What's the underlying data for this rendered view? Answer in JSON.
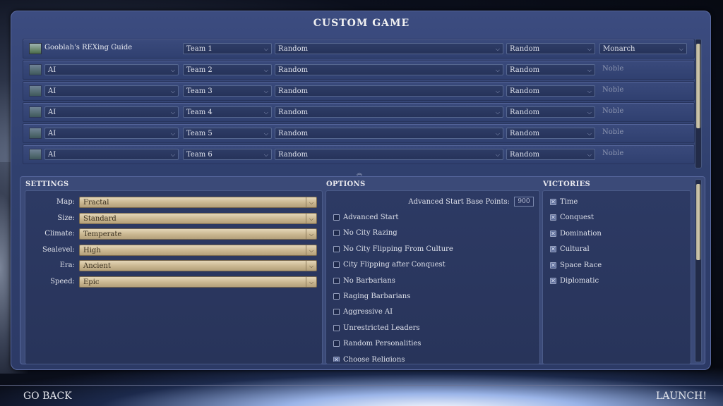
{
  "title": "CUSTOM GAME",
  "players": [
    {
      "leader": "Gooblah's REXing Guide",
      "team": "Team 1",
      "civ": "Random",
      "leader_choice": "Random",
      "difficulty": "Monarch",
      "difficulty_is_dropdown": true,
      "human": true
    },
    {
      "leader": "AI",
      "team": "Team 2",
      "civ": "Random",
      "leader_choice": "Random",
      "difficulty": "Noble",
      "difficulty_is_dropdown": false,
      "human": false
    },
    {
      "leader": "AI",
      "team": "Team 3",
      "civ": "Random",
      "leader_choice": "Random",
      "difficulty": "Noble",
      "difficulty_is_dropdown": false,
      "human": false
    },
    {
      "leader": "AI",
      "team": "Team 4",
      "civ": "Random",
      "leader_choice": "Random",
      "difficulty": "Noble",
      "difficulty_is_dropdown": false,
      "human": false
    },
    {
      "leader": "AI",
      "team": "Team 5",
      "civ": "Random",
      "leader_choice": "Random",
      "difficulty": "Noble",
      "difficulty_is_dropdown": false,
      "human": false
    },
    {
      "leader": "AI",
      "team": "Team 6",
      "civ": "Random",
      "leader_choice": "Random",
      "difficulty": "Noble",
      "difficulty_is_dropdown": false,
      "human": false
    }
  ],
  "settings": {
    "header": "SETTINGS",
    "items": [
      {
        "label": "Map:",
        "value": "Fractal"
      },
      {
        "label": "Size:",
        "value": "Standard"
      },
      {
        "label": "Climate:",
        "value": "Temperate"
      },
      {
        "label": "Sealevel:",
        "value": "High"
      },
      {
        "label": "Era:",
        "value": "Ancient"
      },
      {
        "label": "Speed:",
        "value": "Epic"
      }
    ]
  },
  "options": {
    "header": "OPTIONS",
    "advanced_start_label": "Advanced Start Base Points:",
    "advanced_start_value": "900",
    "items": [
      {
        "label": "Advanced Start",
        "checked": false
      },
      {
        "label": "No City Razing",
        "checked": false
      },
      {
        "label": "No City Flipping From Culture",
        "checked": false
      },
      {
        "label": "City Flipping after Conquest",
        "checked": false
      },
      {
        "label": "No Barbarians",
        "checked": false
      },
      {
        "label": "Raging Barbarians",
        "checked": false
      },
      {
        "label": "Aggressive AI",
        "checked": false
      },
      {
        "label": "Unrestricted Leaders",
        "checked": false
      },
      {
        "label": "Random Personalities",
        "checked": false
      },
      {
        "label": "Choose Religions",
        "checked": true
      }
    ]
  },
  "victories": {
    "header": "VICTORIES",
    "items": [
      {
        "label": "Time",
        "checked": true
      },
      {
        "label": "Conquest",
        "checked": true
      },
      {
        "label": "Domination",
        "checked": true
      },
      {
        "label": "Cultural",
        "checked": true
      },
      {
        "label": "Space Race",
        "checked": true
      },
      {
        "label": "Diplomatic",
        "checked": true
      }
    ]
  },
  "footer": {
    "back_label": "GO BACK",
    "launch_label": "LAUNCH!"
  },
  "icons": {
    "dropdown": "chevron-down-icon",
    "check": "checkmark-icon",
    "leader": "leader-portrait-icon"
  }
}
